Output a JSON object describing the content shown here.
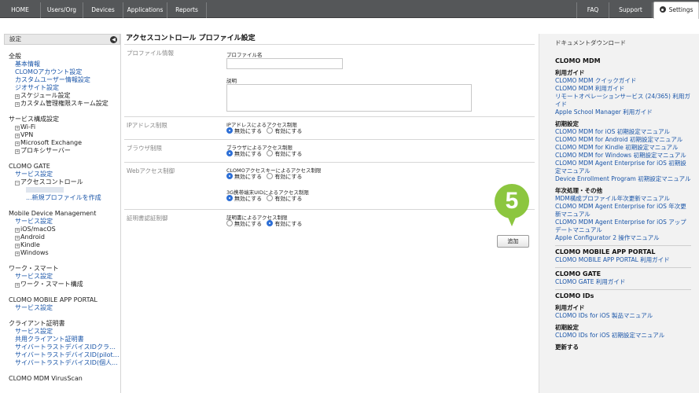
{
  "topnav": {
    "home": "HOME",
    "users": "Users/Org",
    "devices": "Devices",
    "applications": "Applications",
    "reports": "Reports",
    "faq": "FAQ",
    "support": "Support",
    "settings": "Settings"
  },
  "sidebar": {
    "header": "設定",
    "groups": [
      {
        "title": "全般",
        "items": [
          {
            "label": "基本情報",
            "kind": "link"
          },
          {
            "label": "CLOMOアカウント設定",
            "kind": "link"
          },
          {
            "label": "カスタムユーザー情報設定",
            "kind": "link"
          },
          {
            "label": "ジオサイト設定",
            "kind": "link"
          },
          {
            "label": "スケジュール設定",
            "kind": "tree"
          },
          {
            "label": "カスタム管理権限スキーム設定",
            "kind": "tree"
          }
        ]
      },
      {
        "title": "サービス構成設定",
        "items": [
          {
            "label": "Wi-Fi",
            "kind": "tree"
          },
          {
            "label": "VPN",
            "kind": "tree"
          },
          {
            "label": "Microsoft Exchange",
            "kind": "tree"
          },
          {
            "label": "プロキシサーバー",
            "kind": "tree"
          }
        ]
      },
      {
        "title": "CLOMO GATE",
        "items": [
          {
            "label": "サービス設定",
            "kind": "link"
          },
          {
            "label": "アクセスコントロール",
            "kind": "tree-open"
          },
          {
            "label": "",
            "kind": "blurred"
          },
          {
            "label": "...新規プロファイルを作成",
            "kind": "sub-link"
          }
        ]
      },
      {
        "title": "Mobile Device Management",
        "items": [
          {
            "label": "サービス設定",
            "kind": "link"
          },
          {
            "label": "iOS/macOS",
            "kind": "tree"
          },
          {
            "label": "Android",
            "kind": "tree"
          },
          {
            "label": "Kindle",
            "kind": "tree"
          },
          {
            "label": "Windows",
            "kind": "tree"
          }
        ]
      },
      {
        "title": "ワーク・スマート",
        "items": [
          {
            "label": "サービス設定",
            "kind": "link"
          },
          {
            "label": "ワーク・スマート構成",
            "kind": "tree"
          }
        ]
      },
      {
        "title": "CLOMO MOBILE APP PORTAL",
        "items": [
          {
            "label": "サービス設定",
            "kind": "link"
          }
        ]
      },
      {
        "title": "クライアント証明書",
        "items": [
          {
            "label": "サービス設定",
            "kind": "link"
          },
          {
            "label": "共用クライアント証明書",
            "kind": "link"
          },
          {
            "label": "サイバートラストデバイスIDクライ...",
            "kind": "link"
          },
          {
            "label": "サイバートラストデバイスID(pilot)...",
            "kind": "link"
          },
          {
            "label": "サイバートラストデバイスID(個人...",
            "kind": "link"
          }
        ]
      },
      {
        "title": "CLOMO MDM VirusScan",
        "items": []
      }
    ]
  },
  "main": {
    "title": "アクセスコントロール プロファイル設定",
    "profile": {
      "section": "プロファイル情報",
      "name_label": "プロファイル名",
      "desc_label": "説明"
    },
    "ip": {
      "section": "IPアドレス制限",
      "label": "IPアドレスによるアクセス制限",
      "opt_on": "無効にする",
      "opt_off": "有効にする"
    },
    "browser": {
      "section": "ブラウザ制限",
      "label": "ブラウザによるアクセス制限",
      "opt_on": "無効にする",
      "opt_off": "有効にする"
    },
    "web": {
      "section": "Webアクセス制御",
      "label1": "CLOMOアクセスキーによるアクセス制限",
      "label2": "3G携帯端末UIDによるアクセス制限",
      "opt_on": "無効にする",
      "opt_off": "有効にする"
    },
    "cert": {
      "section": "証明書認証制御",
      "label": "証明書によるアクセス制限",
      "opt_off": "無効にする",
      "opt_on": "有効にする"
    },
    "add_button": "追加",
    "callout": "5"
  },
  "rpanel": {
    "title": "ドキュメントダウンロード",
    "blocks": [
      {
        "h1": "CLOMO MDM",
        "subs": [
          {
            "h2": "利用ガイド",
            "links": [
              "CLOMO MDM クイックガイド",
              "CLOMO MDM 利用ガイド",
              "リモートオペレーションサービス (24/365) 利用ガイド",
              "Apple School Manager 利用ガイド"
            ]
          },
          {
            "h2": "初期設定",
            "links": [
              "CLOMO MDM for iOS 初期設定マニュアル",
              "CLOMO MDM for Android 初期設定マニュアル",
              "CLOMO MDM for Kindle 初期設定マニュアル",
              "CLOMO MDM for Windows 初期設定マニュアル",
              "CLOMO MDM Agent Enterprise for iOS 初期設定マニュアル",
              "Device Enrollment Program 初期設定マニュアル"
            ]
          },
          {
            "h2": "年次処理・その他",
            "links": [
              "MDM構成プロファイル年次更新マニュアル",
              "CLOMO MDM Agent Enterprise for iOS 年次更新マニュアル",
              "CLOMO MDM Agent Enterprise for iOS アップデートマニュアル",
              "Apple Configurator 2 操作マニュアル"
            ]
          }
        ]
      },
      {
        "h1": "CLOMO MOBILE APP PORTAL",
        "subs": [
          {
            "h2": "",
            "links": [
              "CLOMO MOBILE APP PORTAL 利用ガイド"
            ]
          }
        ]
      },
      {
        "h1": "CLOMO GATE",
        "subs": [
          {
            "h2": "",
            "links": [
              "CLOMO GATE 利用ガイド"
            ]
          }
        ]
      },
      {
        "h1": "CLOMO IDs",
        "subs": [
          {
            "h2": "利用ガイド",
            "links": [
              "CLOMO IDs for iOS 製品マニュアル"
            ]
          },
          {
            "h2": "初期設定",
            "links": [
              "CLOMO IDs for iOS 初期設定マニュアル"
            ]
          },
          {
            "h2": "更新する",
            "links": []
          }
        ]
      }
    ]
  }
}
